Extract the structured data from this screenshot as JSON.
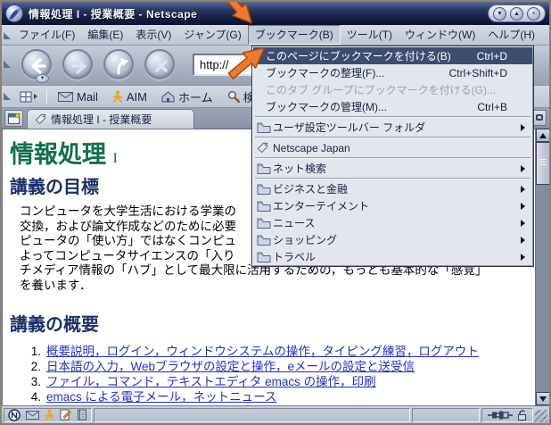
{
  "window": {
    "title": "情報処理 I - 授業概要 - Netscape",
    "controls": [
      {
        "name": "minimize",
        "glyph": "▼"
      },
      {
        "name": "maximize",
        "glyph": "▲"
      },
      {
        "name": "close",
        "glyph": "×"
      }
    ]
  },
  "menubar": {
    "items": [
      {
        "label": "ファイル(F)"
      },
      {
        "label": "編集(E)"
      },
      {
        "label": "表示(V)"
      },
      {
        "label": "ジャンプ(G)"
      },
      {
        "label": "ブックマーク(B)",
        "state": "open"
      },
      {
        "label": "ツール(T)"
      },
      {
        "label": "ウィンドウ(W)"
      },
      {
        "label": "ヘルプ(H)"
      }
    ]
  },
  "bookmark_menu": {
    "items": [
      {
        "label": "このページにブックマークを付ける(B)",
        "accel": "Ctrl+D",
        "state": "highlighted"
      },
      {
        "label": "ブックマークの整理(F)...",
        "accel": "Ctrl+Shift+D"
      },
      {
        "label": "このタブ グループにブックマークを付ける(G)...",
        "state": "disabled"
      },
      {
        "label": "ブックマークの管理(M)...",
        "accel": "Ctrl+B"
      },
      {
        "label": "ユーザ設定ツールバー フォルダ",
        "icon": "folder-icon",
        "submenu": true
      },
      {
        "label": "Netscape Japan",
        "icon": "bookmark-tag-icon"
      },
      {
        "label": "ネット検索",
        "icon": "folder-icon",
        "submenu": true
      },
      {
        "label": "ビジネスと金融",
        "icon": "folder-icon",
        "submenu": true
      },
      {
        "label": "エンターテイメント",
        "icon": "folder-icon",
        "submenu": true
      },
      {
        "label": "ニュース",
        "icon": "folder-icon",
        "submenu": true
      },
      {
        "label": "ショッピング",
        "icon": "folder-icon",
        "submenu": true
      },
      {
        "label": "トラベル",
        "icon": "folder-icon",
        "submenu": true
      }
    ]
  },
  "nav_toolbar": {
    "url_value": "http://",
    "buttons": [
      {
        "name": "back"
      },
      {
        "name": "forward"
      },
      {
        "name": "reload"
      },
      {
        "name": "stop"
      }
    ]
  },
  "personal_toolbar": {
    "items": [
      {
        "label": "Mail",
        "icon": "mail-icon"
      },
      {
        "label": "AIM",
        "icon": "aim-icon"
      },
      {
        "label": "ホーム",
        "icon": "home-icon"
      },
      {
        "label": "検索",
        "icon": "search-icon"
      }
    ]
  },
  "tab_bar": {
    "active_tab_title": "情報処理 I - 授業概要"
  },
  "content": {
    "h1": "情報処理",
    "h1_suffix": "I",
    "section1_heading": "講義の目標",
    "paragraph_lines": [
      "コンピュータを大学生活における学業の",
      "交換，および論文作成などのために必要",
      "ピュータの「使い方」ではなくコンピュ",
      "よってコンピュータサイエンスの「入り",
      "チメディア情報の「ハブ」として最大限に活用するための，もっとも基本的な「感覚」",
      "を養います．"
    ],
    "section2_heading": "講義の概要",
    "list_items": [
      {
        "num": "1.",
        "text": "概要説明，ログイン，ウィンドウシステムの操作，タイピング練習，ログアウト"
      },
      {
        "num": "2.",
        "text": "日本語の入力，Webブラウザの設定と操作，eメールの設定と送受信"
      },
      {
        "num": "3.",
        "text": "ファイル，コマンド，テキストエディタ emacs の操作，印刷"
      },
      {
        "num": "4.",
        "text": "emacs による電子メール，ネットニュース"
      }
    ]
  },
  "status_bar": {
    "component_icons": [
      "navigator-icon",
      "mail-icon",
      "aim-icon",
      "composer-icon",
      "addressbook-icon"
    ],
    "right_icons": [
      "online-plug-icon",
      "security-lock-icon"
    ]
  },
  "annotations": {
    "arrows": [
      {
        "name": "arrow-to-bookmark-menu"
      },
      {
        "name": "arrow-to-highlighted-item"
      }
    ],
    "color": "#ee7b2c"
  },
  "colors": {
    "title_bar": "#1c2749",
    "toolbar": "#bfc7d4",
    "menu_highlight": "#3e4c6e",
    "heading_green": "#12704a",
    "heading_navy": "#1d3069",
    "link_blue": "#2230c8",
    "annotation_orange": "#ee7b2c"
  }
}
